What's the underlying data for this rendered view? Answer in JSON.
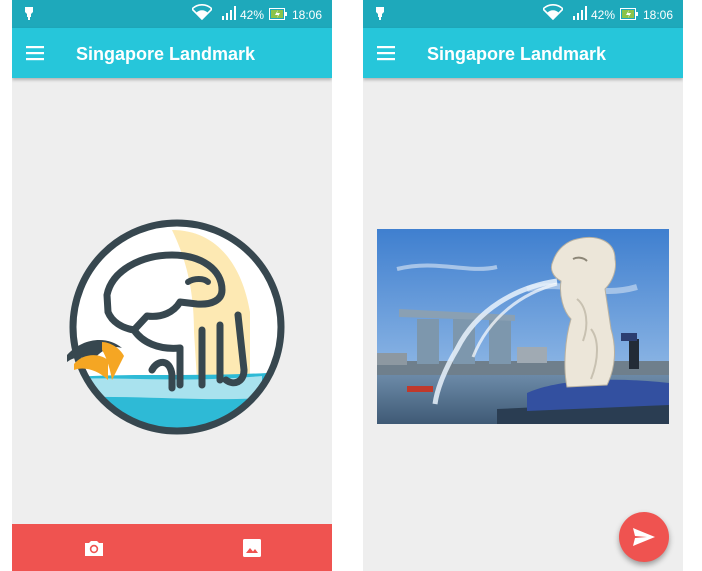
{
  "left_screen": {
    "status_bar": {
      "battery_percent": "42%",
      "time": "18:06"
    },
    "app_bar": {
      "title": "Singapore Landmark"
    },
    "logo": {
      "icon": "merlion-logo"
    },
    "bottom_bar": {
      "buttons": [
        {
          "icon": "camera-icon"
        },
        {
          "icon": "gallery-icon"
        }
      ]
    }
  },
  "right_screen": {
    "status_bar": {
      "battery_percent": "42%",
      "time": "18:06"
    },
    "app_bar": {
      "title": "Singapore Landmark"
    },
    "photo": {
      "subject": "merlion-statue-photo"
    },
    "fab": {
      "icon": "send-icon"
    }
  },
  "colors": {
    "status_bar": "#1ea9bb",
    "app_bar": "#26c6da",
    "accent": "#ef5350",
    "background": "#eeeeee"
  }
}
